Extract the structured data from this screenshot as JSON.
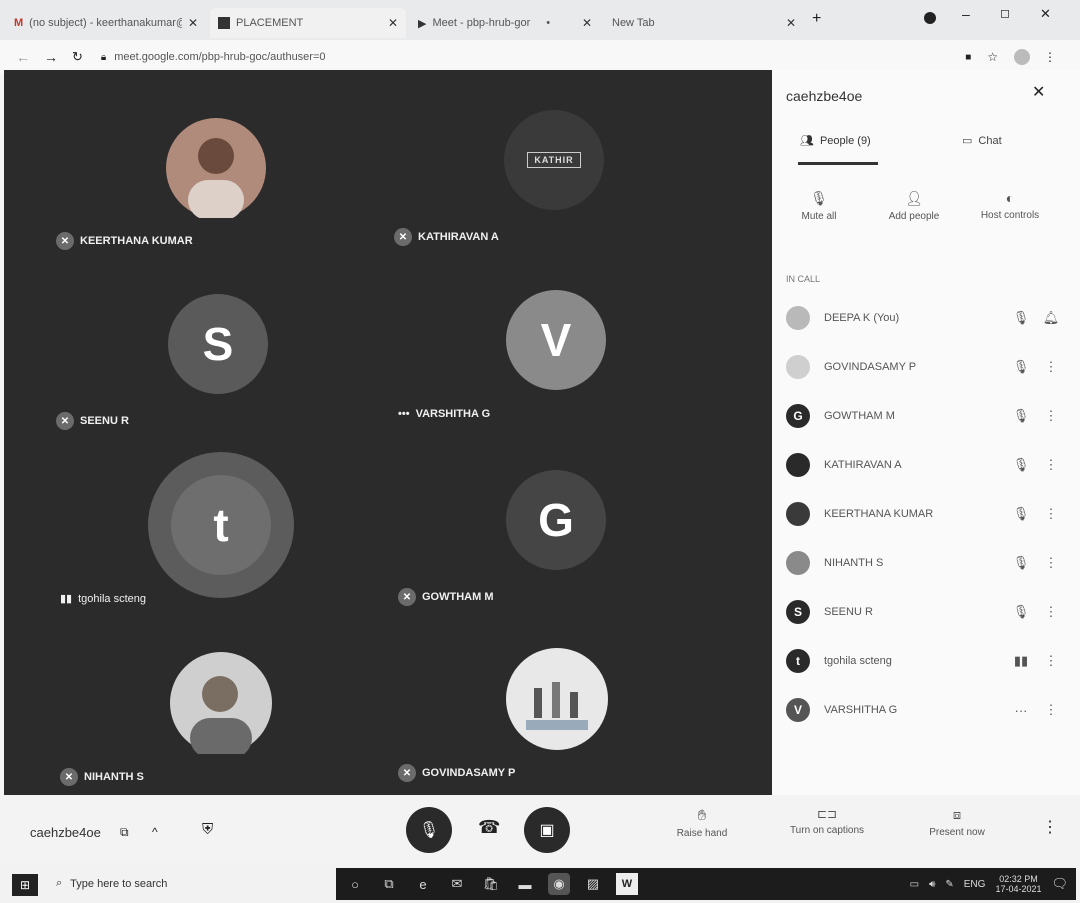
{
  "browser": {
    "tabs": [
      {
        "label": "(no subject) - keerthanakumar@..."
      },
      {
        "label": "PLACEMENT"
      },
      {
        "label": "Meet - pbp-hrub-gor"
      },
      {
        "label": "New Tab"
      }
    ],
    "url": "meet.google.com/pbp-hrub-goc/authuser=0"
  },
  "stage": {
    "tiles": [
      {
        "name": "KEERTHANA KUMAR",
        "initial": "",
        "color": "#b08a7a"
      },
      {
        "name": "KATHIRAVAN A",
        "initial": "",
        "color": "#3a3a3a"
      },
      {
        "name": "SEENU R",
        "initial": "S",
        "color": "#5a5a5a"
      },
      {
        "name": "VARSHITHA G",
        "initial": "V",
        "color": "#8a8a8a"
      },
      {
        "name": "tgohila scteng",
        "initial": "t",
        "color": "#6e6e6e"
      },
      {
        "name": "GOWTHAM M",
        "initial": "G",
        "color": "#454545"
      },
      {
        "name": "NIHANTH S",
        "initial": "",
        "color": "#cfcfcf"
      },
      {
        "name": "GOVINDASAMY P",
        "initial": "",
        "color": "#e8e8e8"
      }
    ]
  },
  "panel": {
    "meeting_code": "caehzbe4oe",
    "tab_people": "People (9)",
    "tab_chat": "Chat",
    "actions": {
      "mute_all": "Mute all",
      "add_people": "Add people",
      "host_controls": "Host controls"
    },
    "section": "IN CALL",
    "people": [
      {
        "name": "DEEPA K (You)",
        "initial": "",
        "color": "#b9b9b9"
      },
      {
        "name": "GOVINDASAMY P",
        "initial": "",
        "color": "#cfcfcf"
      },
      {
        "name": "GOWTHAM M",
        "initial": "G",
        "color": "#2a2a2a"
      },
      {
        "name": "KATHIRAVAN A",
        "initial": "",
        "color": "#2a2a2a"
      },
      {
        "name": "KEERTHANA KUMAR",
        "initial": "",
        "color": "#3a3a3a"
      },
      {
        "name": "NIHANTH S",
        "initial": "",
        "color": "#8a8a8a"
      },
      {
        "name": "SEENU R",
        "initial": "S",
        "color": "#2a2a2a"
      },
      {
        "name": "tgohila scteng",
        "initial": "t",
        "color": "#2a2a2a"
      },
      {
        "name": "VARSHITHA G",
        "initial": "V",
        "color": "#555555"
      }
    ]
  },
  "bottom": {
    "meeting_code": "caehzbe4oe",
    "raise_hand": "Raise hand",
    "captions": "Turn on captions",
    "present": "Present now"
  },
  "taskbar": {
    "search_placeholder": "Type here to search",
    "lang": "ENG",
    "time": "02:32 PM",
    "date": "17-04-2021"
  }
}
